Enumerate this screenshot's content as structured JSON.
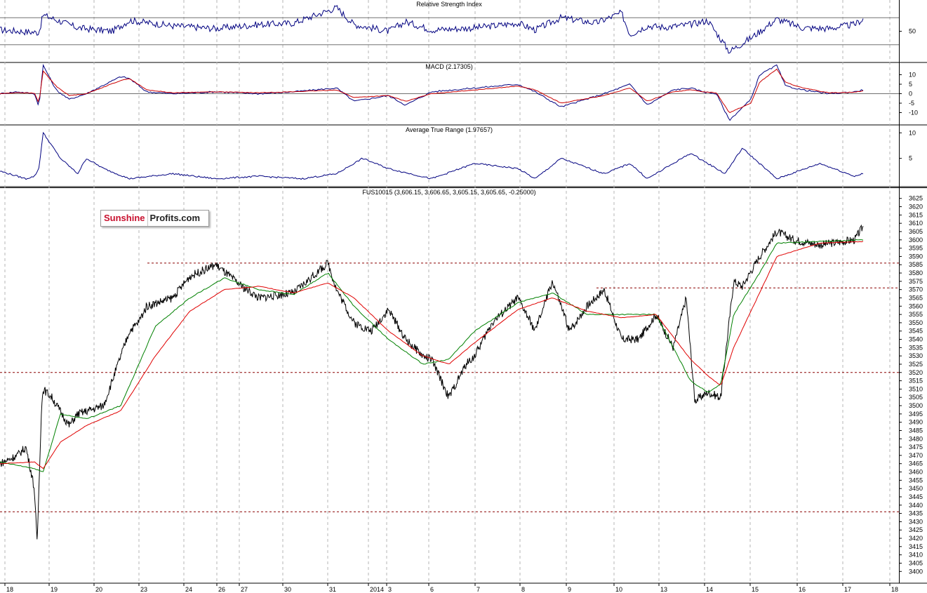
{
  "logo": {
    "part1": "Sunshine",
    "part2": "Profits.com"
  },
  "colors": {
    "price": "#000000",
    "ma_fast": "#008000",
    "ma_slow": "#e00000",
    "indicator": "#000080",
    "macd_signal": "#cc0000",
    "support": "#8b0000",
    "grid": "#b4b4b4",
    "rsi_level": "#707070"
  },
  "chart_data": [
    {
      "type": "line",
      "title": "Relative Strength Index",
      "yticks": [
        50
      ],
      "levels": [
        70,
        30
      ],
      "ylim": [
        10,
        90
      ],
      "series": [
        {
          "color": "#000080",
          "x": [
            0,
            0.045,
            0.05,
            0.09,
            0.13,
            0.15,
            0.2,
            0.25,
            0.3,
            0.34,
            0.39,
            0.41,
            0.45,
            0.47,
            0.5,
            0.55,
            0.6,
            0.62,
            0.65,
            0.69,
            0.72,
            0.73,
            0.75,
            0.77,
            0.8,
            0.82,
            0.845,
            0.87,
            0.9,
            0.93,
            0.96,
            0.99,
            1
          ],
          "y": [
            52,
            48,
            74,
            55,
            50,
            66,
            58,
            54,
            60,
            62,
            85,
            60,
            50,
            64,
            52,
            55,
            62,
            52,
            70,
            62,
            77,
            45,
            58,
            56,
            60,
            66,
            20,
            40,
            68,
            55,
            54,
            60,
            68
          ]
        }
      ]
    },
    {
      "type": "line",
      "title": "MACD (2.17305)",
      "yticks": [
        10,
        5,
        0,
        -5,
        -10
      ],
      "ylim": [
        -15,
        15
      ],
      "series": [
        {
          "color": "#000080",
          "x": [
            0,
            0.02,
            0.04,
            0.045,
            0.05,
            0.065,
            0.08,
            0.1,
            0.14,
            0.15,
            0.17,
            0.2,
            0.25,
            0.3,
            0.34,
            0.39,
            0.41,
            0.45,
            0.47,
            0.5,
            0.55,
            0.6,
            0.62,
            0.65,
            0.7,
            0.73,
            0.75,
            0.78,
            0.8,
            0.815,
            0.83,
            0.845,
            0.87,
            0.88,
            0.9,
            0.91,
            0.93,
            0.96,
            0.99,
            1
          ],
          "y": [
            0,
            1,
            0,
            -7,
            15,
            2,
            -3,
            0,
            9,
            8,
            1,
            0,
            1,
            0,
            1,
            3,
            -4,
            -1,
            -6,
            1,
            3,
            5,
            1,
            -7,
            0,
            5,
            -6,
            2,
            3,
            1,
            0,
            -14,
            -3,
            10,
            15,
            4,
            2,
            0,
            1,
            2
          ]
        },
        {
          "color": "#cc0000",
          "x": [
            0,
            0.02,
            0.04,
            0.045,
            0.05,
            0.065,
            0.08,
            0.1,
            0.14,
            0.15,
            0.17,
            0.2,
            0.25,
            0.3,
            0.34,
            0.39,
            0.41,
            0.45,
            0.47,
            0.5,
            0.55,
            0.6,
            0.62,
            0.65,
            0.7,
            0.73,
            0.75,
            0.78,
            0.8,
            0.815,
            0.83,
            0.845,
            0.87,
            0.88,
            0.9,
            0.91,
            0.93,
            0.96,
            0.99,
            1
          ],
          "y": [
            0,
            0.6,
            0.2,
            -5,
            12,
            4,
            -1,
            0,
            7,
            8,
            2,
            0.5,
            1,
            0.5,
            1,
            2,
            -2,
            -1,
            -4,
            0,
            2,
            4,
            2,
            -5,
            -1,
            3,
            -4,
            1,
            2,
            1,
            0.5,
            -10,
            -5,
            6,
            13,
            6,
            3,
            0.5,
            0.8,
            1.5
          ]
        }
      ]
    },
    {
      "type": "line",
      "title": "Average True Range (1.97657)",
      "yticks": [
        10,
        5
      ],
      "ylim": [
        0,
        11
      ],
      "series": [
        {
          "color": "#000080",
          "x": [
            0,
            0.03,
            0.04,
            0.045,
            0.05,
            0.07,
            0.09,
            0.1,
            0.12,
            0.15,
            0.2,
            0.25,
            0.3,
            0.35,
            0.39,
            0.42,
            0.45,
            0.5,
            0.55,
            0.6,
            0.62,
            0.65,
            0.7,
            0.73,
            0.75,
            0.8,
            0.83,
            0.84,
            0.86,
            0.9,
            0.95,
            0.99,
            1
          ],
          "y": [
            2.5,
            1,
            1.5,
            3,
            10,
            5,
            2,
            5,
            3,
            1,
            2,
            1,
            1.5,
            1,
            2,
            5,
            3,
            1,
            4,
            3,
            1,
            5,
            2,
            4,
            1,
            6,
            3,
            2,
            7,
            1,
            4,
            1.5,
            2
          ]
        }
      ]
    },
    {
      "type": "line",
      "title": "FUS10015 (3,606.15, 3,606.65, 3,605.15, 3,605.65, -0.25000)",
      "yticks": [
        3625,
        3620,
        3615,
        3610,
        3605,
        3600,
        3595,
        3590,
        3585,
        3580,
        3575,
        3570,
        3565,
        3560,
        3555,
        3550,
        3545,
        3540,
        3535,
        3530,
        3525,
        3520,
        3515,
        3510,
        3505,
        3500,
        3495,
        3490,
        3485,
        3480,
        3475,
        3470,
        3465,
        3460,
        3455,
        3450,
        3445,
        3440,
        3435,
        3430,
        3425,
        3420,
        3415,
        3410,
        3405,
        3400
      ],
      "ylim": [
        3398,
        3627
      ],
      "xticks": [
        "18",
        "19",
        "20",
        "23",
        "24",
        "26",
        "27",
        "30",
        "31",
        "2014",
        "3",
        "6",
        "7",
        "8",
        "9",
        "10",
        "13",
        "14",
        "15",
        "16",
        "17",
        "18"
      ],
      "support_levels": [
        3586,
        3571,
        3520,
        3436
      ],
      "series": [
        {
          "name": "price",
          "color": "#000000",
          "x": [
            0,
            0.02,
            0.03,
            0.038,
            0.04,
            0.043,
            0.048,
            0.05,
            0.06,
            0.08,
            0.09,
            0.12,
            0.14,
            0.15,
            0.16,
            0.17,
            0.2,
            0.22,
            0.25,
            0.28,
            0.3,
            0.34,
            0.38,
            0.39,
            0.41,
            0.43,
            0.45,
            0.47,
            0.49,
            0.5,
            0.52,
            0.54,
            0.55,
            0.57,
            0.6,
            0.62,
            0.64,
            0.66,
            0.68,
            0.7,
            0.72,
            0.74,
            0.76,
            0.78,
            0.795,
            0.805,
            0.82,
            0.835,
            0.85,
            0.86,
            0.88,
            0.9,
            0.92,
            0.95,
            0.99,
            1
          ],
          "y": [
            3465,
            3470,
            3475,
            3455,
            3448,
            3416,
            3498,
            3510,
            3505,
            3488,
            3495,
            3500,
            3530,
            3545,
            3550,
            3560,
            3565,
            3578,
            3585,
            3572,
            3565,
            3568,
            3586,
            3570,
            3550,
            3545,
            3558,
            3540,
            3530,
            3528,
            3505,
            3525,
            3530,
            3550,
            3565,
            3545,
            3575,
            3545,
            3560,
            3570,
            3540,
            3540,
            3555,
            3535,
            3565,
            3503,
            3508,
            3505,
            3575,
            3572,
            3590,
            3605,
            3600,
            3597,
            3600,
            3608
          ]
        },
        {
          "name": "ma_fast",
          "color": "#008000",
          "x": [
            0,
            0.04,
            0.05,
            0.07,
            0.1,
            0.14,
            0.18,
            0.22,
            0.26,
            0.3,
            0.34,
            0.38,
            0.41,
            0.45,
            0.49,
            0.52,
            0.55,
            0.6,
            0.64,
            0.68,
            0.72,
            0.76,
            0.8,
            0.82,
            0.835,
            0.85,
            0.88,
            0.9,
            0.95,
            1
          ],
          "y": [
            3466,
            3462,
            3460,
            3495,
            3492,
            3500,
            3548,
            3565,
            3577,
            3570,
            3567,
            3580,
            3560,
            3540,
            3525,
            3528,
            3545,
            3562,
            3568,
            3555,
            3555,
            3555,
            3515,
            3508,
            3513,
            3555,
            3580,
            3598,
            3599,
            3600
          ]
        },
        {
          "name": "ma_slow",
          "color": "#e00000",
          "x": [
            0,
            0.04,
            0.05,
            0.07,
            0.1,
            0.14,
            0.18,
            0.22,
            0.26,
            0.3,
            0.34,
            0.38,
            0.41,
            0.45,
            0.49,
            0.52,
            0.55,
            0.6,
            0.64,
            0.68,
            0.72,
            0.76,
            0.8,
            0.82,
            0.835,
            0.85,
            0.88,
            0.9,
            0.95,
            1
          ],
          "y": [
            3465,
            3466,
            3462,
            3478,
            3488,
            3497,
            3530,
            3557,
            3570,
            3572,
            3568,
            3574,
            3565,
            3545,
            3530,
            3525,
            3538,
            3558,
            3565,
            3557,
            3553,
            3555,
            3528,
            3518,
            3512,
            3535,
            3568,
            3590,
            3598,
            3599
          ]
        }
      ]
    }
  ]
}
